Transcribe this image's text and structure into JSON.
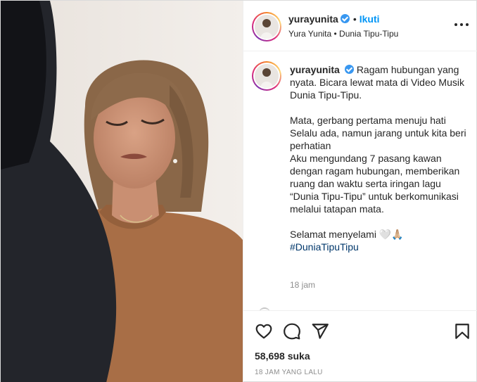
{
  "post": {
    "username": "yurayunita",
    "verified": true,
    "follow_label": "Ikuti",
    "separator": "•",
    "subtitle": "Yura Yunita • Dunia Tipu-Tipu",
    "caption_lead": "Ragam hubungan yang nyata. Bicara lewat mata di Video Musik Dunia Tipu-Tipu.",
    "caption_body": "Mata, gerbang pertama menuju hati\nSelalu ada, namun jarang untuk kita beri perhatian\nAku mengundang 7 pasang kawan dengan ragam hubungan, memberikan ruang dan waktu serta iringan lagu “Dunia Tipu-Tipu” untuk berkomunikasi melalui tatapan mata.",
    "caption_closing": "Selamat menyelami 🤍🙏🏼",
    "hashtag": "#DuniaTipuTipu",
    "caption_time": "18 jam",
    "likes": "58,698 suka",
    "posted_ago": "18 JAM YANG LALU"
  },
  "icons": {
    "like": "heart-icon",
    "comment": "comment-icon",
    "share": "paper-plane-icon",
    "save": "bookmark-icon",
    "more": "more-options-icon"
  },
  "colors": {
    "link_blue": "#0095f6",
    "hashtag": "#00376b",
    "verified": "#3897f0",
    "muted": "#8e8e8e",
    "text": "#262626"
  }
}
